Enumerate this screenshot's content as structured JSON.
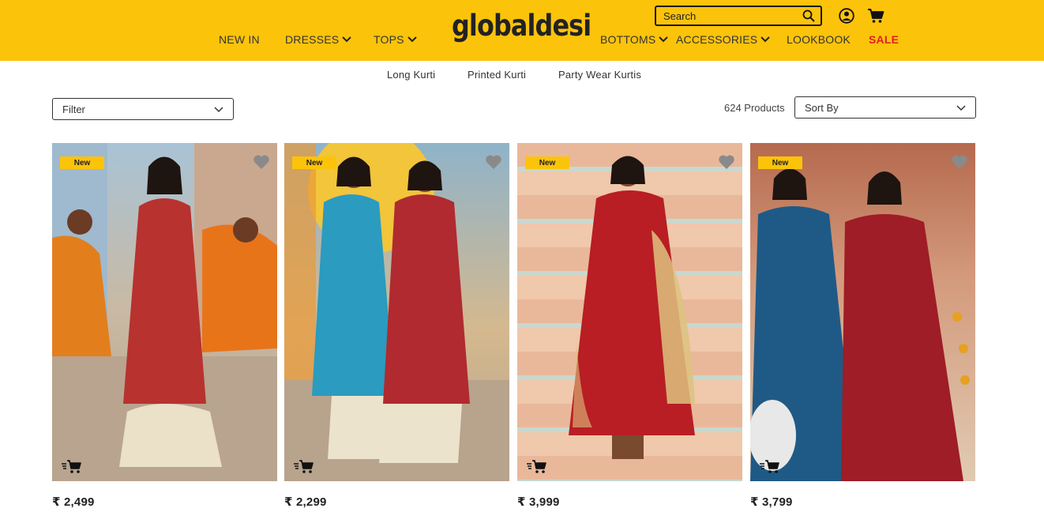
{
  "brand": {
    "logo_text": "globaldesi",
    "accent_color": "#fcc30b",
    "sale_color": "#e02020"
  },
  "header": {
    "nav_left": [
      {
        "label": "NEW IN",
        "has_dropdown": false
      },
      {
        "label": "DRESSES",
        "has_dropdown": true
      },
      {
        "label": "TOPS",
        "has_dropdown": true
      }
    ],
    "nav_right": [
      {
        "label": "BOTTOMS",
        "has_dropdown": true
      },
      {
        "label": "ACCESSORIES",
        "has_dropdown": true
      },
      {
        "label": "LOOKBOOK",
        "has_dropdown": false
      },
      {
        "label": "SALE",
        "has_dropdown": false
      }
    ],
    "search": {
      "placeholder": "Search",
      "value": "",
      "icon": "search-icon"
    },
    "icons": [
      "user-icon",
      "cart-icon"
    ]
  },
  "subnav": [
    "Long Kurti",
    "Printed Kurti",
    "Party Wear Kurtis"
  ],
  "toolbar": {
    "filter_label": "Filter",
    "products_count": "624 Products",
    "sort_label": "Sort By"
  },
  "products": [
    {
      "badge": "New",
      "price": "₹ 2,499",
      "palette": [
        "#a9c3d6",
        "#b8322f",
        "#e8dcc4",
        "#e27f1c"
      ]
    },
    {
      "badge": "New",
      "price": "₹ 2,299",
      "palette": [
        "#f2c53a",
        "#2b9bbf",
        "#b02a30",
        "#ece3cc"
      ]
    },
    {
      "badge": "New",
      "price": "₹ 3,999",
      "palette": [
        "#e9b89a",
        "#b81e24",
        "#ddc27f",
        "#c8a070"
      ]
    },
    {
      "badge": "New",
      "price": "₹ 3,799",
      "palette": [
        "#c88a6a",
        "#1f5a86",
        "#9e1d26",
        "#e0cbb3"
      ]
    }
  ]
}
